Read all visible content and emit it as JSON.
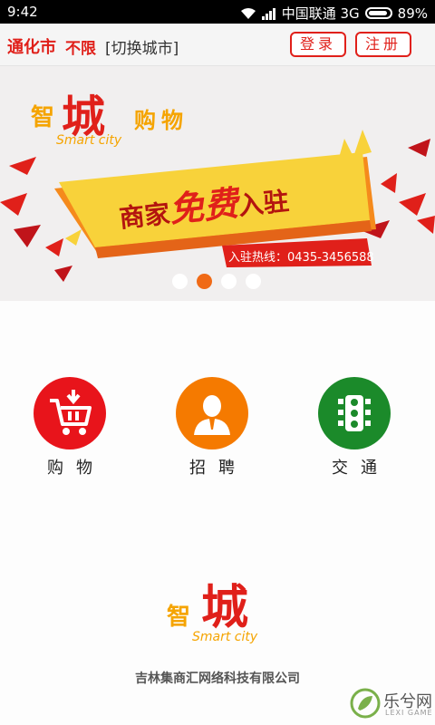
{
  "status_bar": {
    "time": "9:42",
    "carrier": "中国联通 3G",
    "battery": "89%",
    "battery_level": 0.89,
    "icons": [
      "wifi-icon",
      "signal-icon",
      "battery-icon"
    ]
  },
  "header": {
    "city": "通化市",
    "district": "不限",
    "switch_city": "[切换城市]",
    "login": "登录",
    "register": "注册"
  },
  "banner": {
    "brand_char_1": "智",
    "brand_char_2": "城",
    "brand_suffix": "购物",
    "brand_en": "Smart city",
    "slogan_part1": "商家",
    "slogan_highlight": "免费",
    "slogan_part2": "入驻",
    "hotline": "入驻热线：0435-3456588",
    "slides": 4,
    "active_slide": 2
  },
  "menu": [
    {
      "label": "购物",
      "icon": "shopping-cart-icon",
      "color": "#e8141b"
    },
    {
      "label": "招聘",
      "icon": "person-icon",
      "color": "#f57a00"
    },
    {
      "label": "交通",
      "icon": "traffic-light-icon",
      "color": "#1b8a2a"
    }
  ],
  "footer": {
    "logo_char_1": "智",
    "logo_char_2": "城",
    "logo_en": "Smart city",
    "company": "吉林集商汇网络科技有限公司"
  },
  "watermark": {
    "text": "乐兮网",
    "sub": "LEXI GAME"
  },
  "colors": {
    "brand_red": "#e0201a",
    "accent_orange": "#f06a16",
    "banner_yellow": "#f8d23a"
  }
}
